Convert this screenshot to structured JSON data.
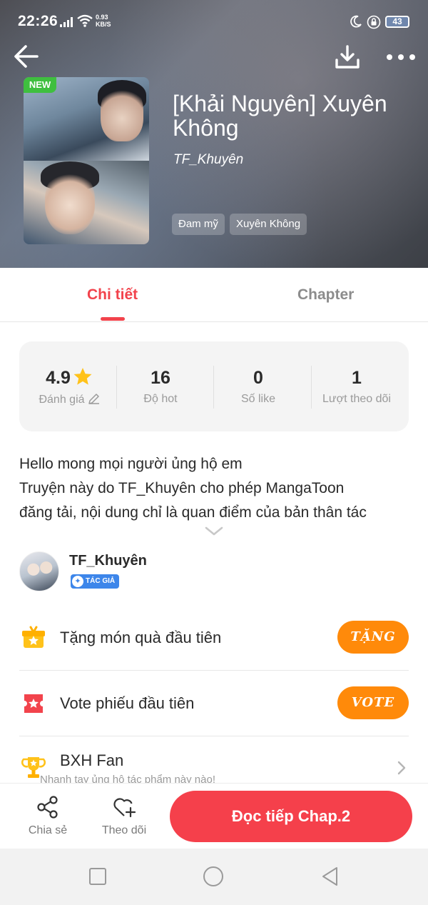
{
  "status_bar": {
    "time": "22:26",
    "net_speed_value": "0.93",
    "net_speed_unit": "KB/S",
    "battery": "43"
  },
  "manga": {
    "new_badge": "NEW",
    "title": "[Khải Nguyên] Xuyên Không",
    "author": "TF_Khuyên",
    "tags": [
      "Đam mỹ",
      "Xuyên Không"
    ]
  },
  "tabs": {
    "details": "Chi tiết",
    "chapter": "Chapter"
  },
  "stats": {
    "rating_value": "4.9",
    "rating_label": "Đánh giá",
    "hot_value": "16",
    "hot_label": "Độ hot",
    "like_value": "0",
    "like_label": "Số like",
    "follow_value": "1",
    "follow_label": "Lượt theo dõi"
  },
  "description": {
    "line1": "Hello mong mọi người ủng hộ em",
    "line2": "Truyện này do TF_Khuyên cho phép MangaToon",
    "line3": "đăng tải, nội dung chỉ là quan điểm của bản thân tác"
  },
  "author_row": {
    "name": "TF_Khuyên",
    "badge": "TÁC GIẢ"
  },
  "actions": {
    "gift_label": "Tặng món quà đầu tiên",
    "gift_button": "TẶNG",
    "vote_label": "Vote phiếu đầu tiên",
    "vote_button": "VOTE",
    "fan_label": "BXH Fan",
    "fan_sub": "Nhanh tay ủng hộ tác phẩm này nào!"
  },
  "bottom_bar": {
    "share_label": "Chia sẻ",
    "follow_label": "Theo dõi",
    "read_button": "Đọc tiếp Chap.2"
  },
  "colors": {
    "accent": "#f2434c",
    "button_orange": "#ff8a0a",
    "read_button": "#f5404b",
    "new_badge": "#3fbf3f"
  }
}
